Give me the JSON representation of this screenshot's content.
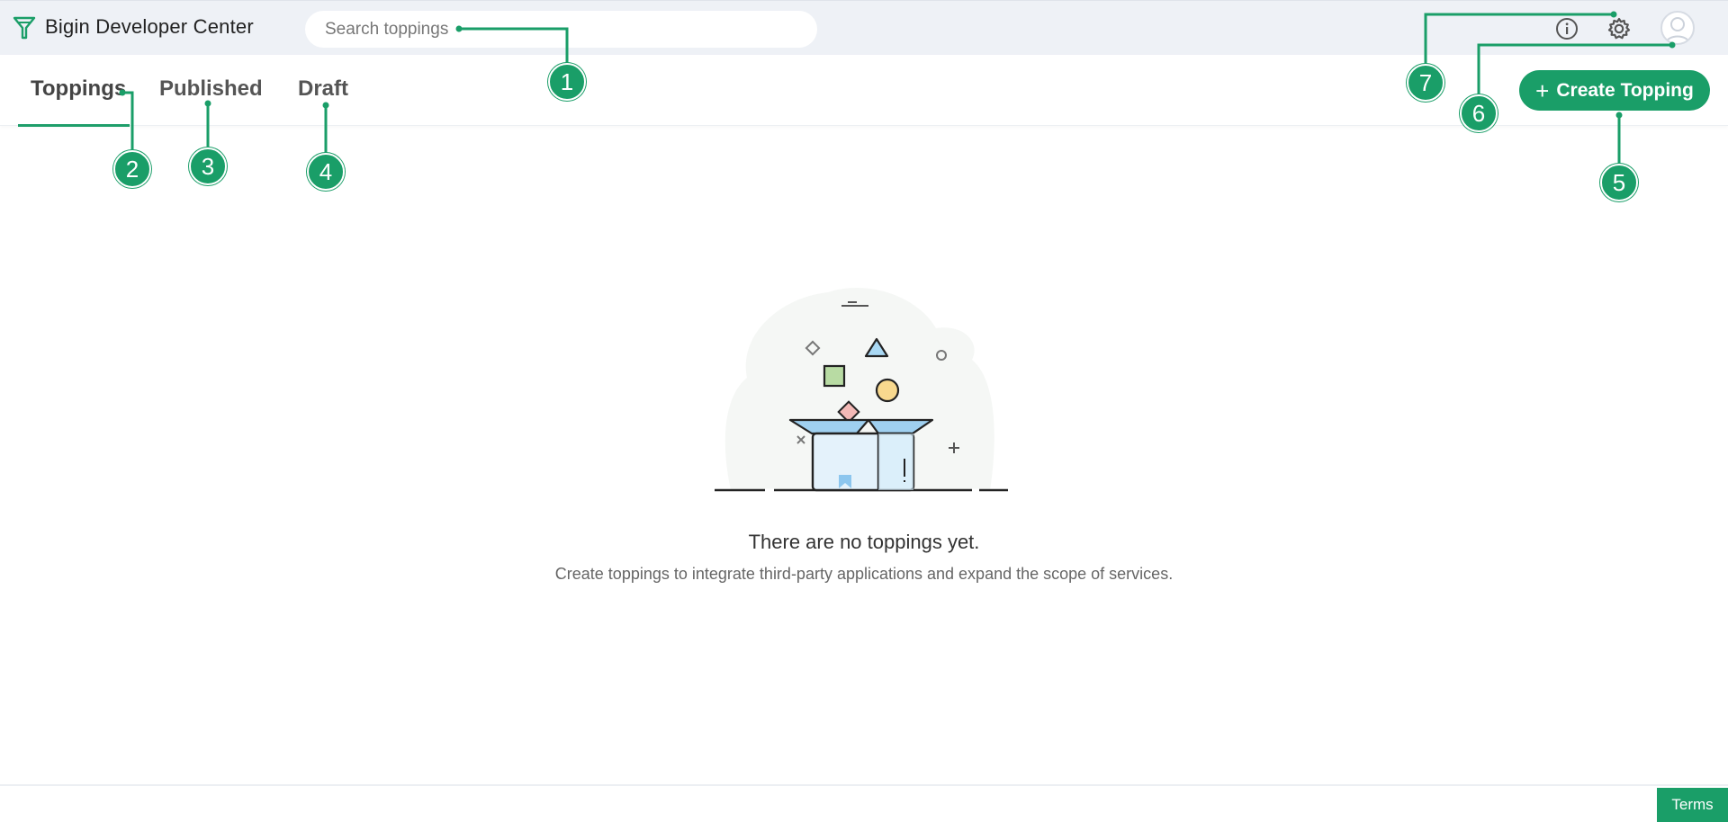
{
  "header": {
    "app_title": "Bigin Developer Center",
    "logo_icon": "bigin-funnel-logo-icon",
    "search_placeholder": "Search toppings",
    "info_icon": "info-icon",
    "settings_icon": "gear-icon",
    "avatar_icon": "user-avatar-icon"
  },
  "tabs": [
    {
      "label": "Toppings",
      "active": true
    },
    {
      "label": "Published",
      "active": false
    },
    {
      "label": "Draft",
      "active": false
    }
  ],
  "actions": {
    "create_label": "Create Topping",
    "create_icon": "plus-icon"
  },
  "empty_state": {
    "title": "There are no toppings yet.",
    "description": "Create toppings to integrate third-party applications and expand the scope of services.",
    "illustration": "open-box-icon"
  },
  "footer": {
    "terms_label": "Terms"
  },
  "callouts": [
    "1",
    "2",
    "3",
    "4",
    "5",
    "6",
    "7"
  ],
  "colors": {
    "accent": "#1a9e68",
    "topbar_bg": "#eef1f6"
  }
}
